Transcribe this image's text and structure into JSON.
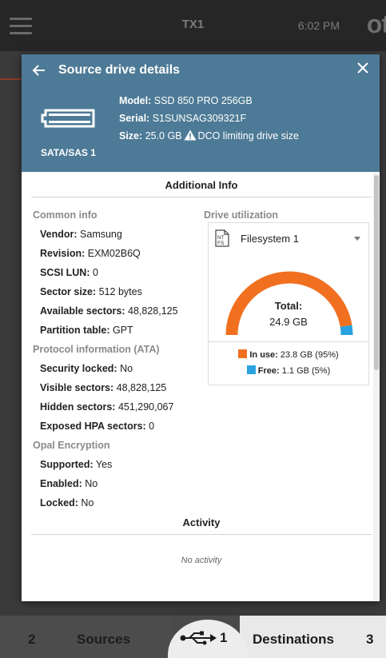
{
  "app": {
    "title": "TX1",
    "time": "6:02 PM",
    "logo": "ot"
  },
  "modal": {
    "title": "Source drive details",
    "drive": {
      "port": "SATA/SAS 1",
      "model_label": "Model:",
      "model": "SSD 850 PRO 256GB",
      "serial_label": "Serial:",
      "serial": "S1SUNSAG309321F",
      "size_label": "Size:",
      "size": "25.0 GB",
      "dco_note": "DCO limiting drive size"
    },
    "additional_info_title": "Additional Info",
    "common_info": {
      "heading": "Common info",
      "rows": [
        {
          "label": "Vendor:",
          "value": "Samsung"
        },
        {
          "label": "Revision:",
          "value": "EXM02B6Q"
        },
        {
          "label": "SCSI LUN:",
          "value": "0"
        },
        {
          "label": "Sector size:",
          "value": "512 bytes"
        },
        {
          "label": "Available sectors:",
          "value": "48,828,125"
        },
        {
          "label": "Partition table:",
          "value": "GPT"
        }
      ]
    },
    "protocol_info": {
      "heading": "Protocol information (ATA)",
      "rows": [
        {
          "label": "Security locked:",
          "value": "No"
        },
        {
          "label": "Visible sectors:",
          "value": "48,828,125"
        },
        {
          "label": "Hidden sectors:",
          "value": "451,290,067"
        },
        {
          "label": "Exposed HPA sectors:",
          "value": "0"
        }
      ]
    },
    "opal": {
      "heading": "Opal Encryption",
      "rows": [
        {
          "label": "Supported:",
          "value": "Yes"
        },
        {
          "label": "Enabled:",
          "value": "No"
        },
        {
          "label": "Locked:",
          "value": "No"
        }
      ]
    },
    "utilization": {
      "heading": "Drive utilization",
      "fs_icon_text_top": "NT",
      "fs_icon_text_bottom": "FS",
      "selected_filesystem": "Filesystem 1",
      "total_label": "Total:",
      "total_value": "24.9 GB",
      "in_use_label": "In use:",
      "in_use_value": "23.8 GB (95%)",
      "in_use_fraction": 0.95,
      "in_use_color": "#f07020",
      "free_label": "Free:",
      "free_value": "1.1 GB (5%)",
      "free_color": "#29a3e0"
    },
    "activity_title": "Activity",
    "activity_empty": "No activity"
  },
  "bottom_nav": {
    "sources_count": "2",
    "sources_label": "Sources",
    "usb_count": "1",
    "destinations_label": "Destinations",
    "destinations_count": "3"
  },
  "colors": {
    "header": "#4d7a96",
    "appbar": "#262626"
  }
}
